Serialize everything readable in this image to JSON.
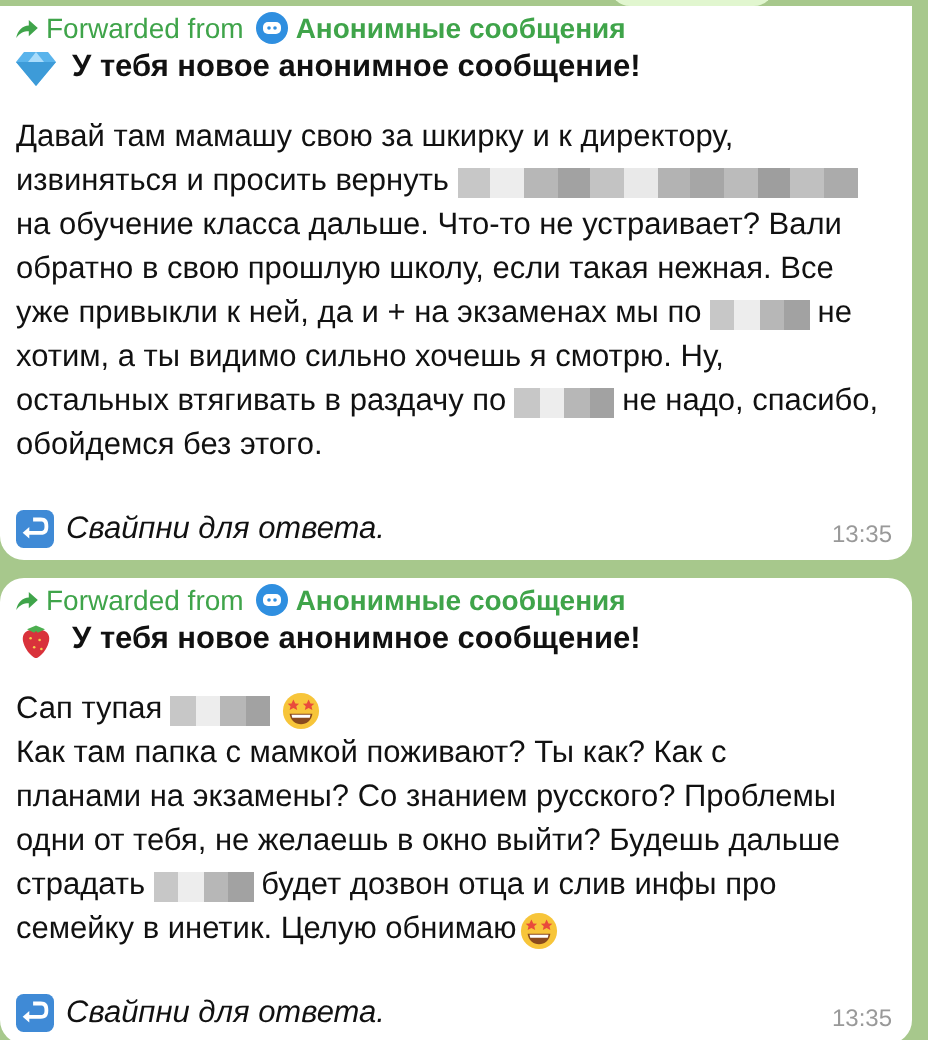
{
  "messages": [
    {
      "forwarded_label": "Forwarded from",
      "source": "Анонимные сообщения",
      "kind": "diamond",
      "title": "У тебя новое анонимное сообщение!",
      "lines": [
        [
          {
            "kind": "text",
            "text": "Давай там мамашу свою за шкирку и к директору,"
          }
        ],
        [
          {
            "kind": "text",
            "text": "извиняться и просить вернуть"
          },
          {
            "kind": "redacted-long"
          }
        ],
        [
          {
            "kind": "text",
            "text": "на обучение класса дальше. Что-то не устраивает? Вали"
          }
        ],
        [
          {
            "kind": "text",
            "text": "обратно в свою прошлую школу, если такая нежная. Все"
          }
        ],
        [
          {
            "kind": "text",
            "text": "уже привыкли к ней, да и + на экзаменах мы по"
          },
          {
            "kind": "redacted"
          },
          {
            "kind": "text",
            "text": "не"
          }
        ],
        [
          {
            "kind": "text",
            "text": "хотим, а ты видимо сильно хочешь я смотрю. Ну,"
          }
        ],
        [
          {
            "kind": "text",
            "text": "остальных втягивать в раздачу по"
          },
          {
            "kind": "redacted"
          },
          {
            "kind": "text",
            "text": "не надо, спасибо,"
          }
        ],
        [
          {
            "kind": "text",
            "text": "обойдемся без этого."
          }
        ]
      ],
      "footer": "Свайпни для ответа.",
      "time": "13:35"
    },
    {
      "forwarded_label": "Forwarded from",
      "source": "Анонимные сообщения",
      "kind": "strawberry",
      "title": "У тебя новое анонимное сообщение!",
      "lines": [
        [
          {
            "kind": "text",
            "text": "Сап тупая"
          },
          {
            "kind": "redacted"
          },
          {
            "kind": "emoji"
          }
        ],
        [
          {
            "kind": "text",
            "text": "Как там папка с мамкой поживают? Ты как? Как с"
          }
        ],
        [
          {
            "kind": "text",
            "text": "планами на экзамены? Со знанием русского? Проблемы"
          }
        ],
        [
          {
            "kind": "text",
            "text": "одни от тебя, не желаешь в окно выйти? Будешь дальше"
          }
        ],
        [
          {
            "kind": "text",
            "text": "страдать"
          },
          {
            "kind": "redacted"
          },
          {
            "kind": "text",
            "text": "будет дозвон отца и слив инфы про"
          }
        ],
        [
          {
            "kind": "text",
            "text": "семейку в инетик. Целую обнимаю"
          },
          {
            "kind": "emoji"
          }
        ]
      ],
      "footer": "Свайпни для ответа.",
      "time": "13:35"
    }
  ]
}
